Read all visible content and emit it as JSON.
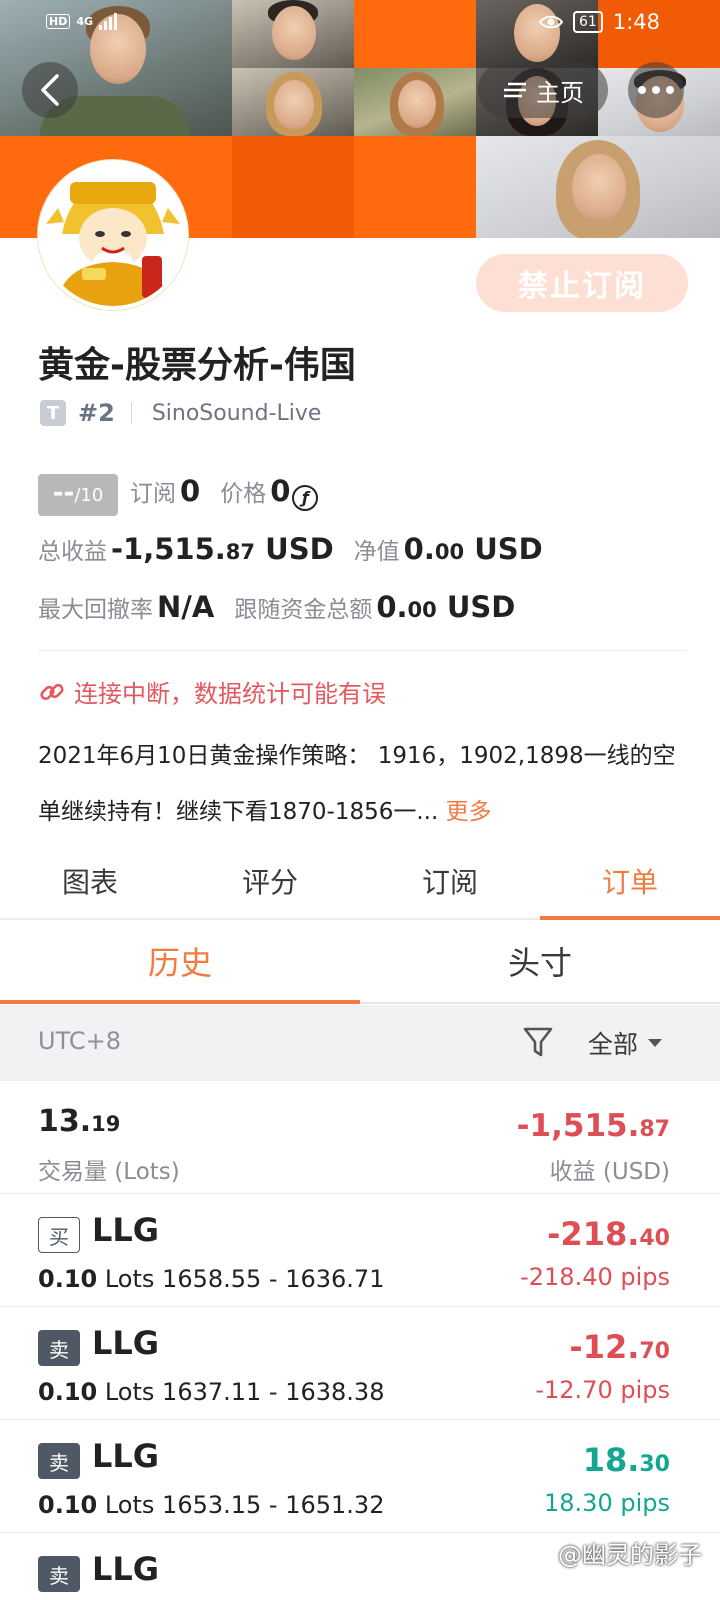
{
  "status_bar": {
    "signal_labels": [
      "HD",
      "4G"
    ],
    "battery": "61",
    "time": "1:48"
  },
  "header": {
    "home_label": "主页",
    "icons": [
      "back-arrow-icon",
      "menu-lines-icon",
      "more-dots-icon",
      "eye-icon"
    ]
  },
  "profile": {
    "name": "黄金-股票分析-伟国",
    "rank": "#2",
    "server": "SinoSound-Live",
    "type_badge": "T",
    "subscribe_button": "禁止订阅"
  },
  "stats": {
    "score": "--",
    "score_max": "/10",
    "subscriptions_label": "订阅",
    "subscriptions_value": "0",
    "price_label": "价格",
    "price_value": "0",
    "currency_symbol": "ƒ",
    "total_profit_label": "总收益",
    "total_profit_int": "-1,515.",
    "total_profit_dec": "87",
    "total_profit_unit": "USD",
    "net_value_label": "净值",
    "net_value_int": "0.",
    "net_value_dec": "00",
    "net_value_unit": "USD",
    "max_drawdown_label": "最大回撤率",
    "max_drawdown_value": "N/A",
    "follow_funds_label": "跟随资金总额",
    "follow_funds_int": "0.",
    "follow_funds_dec": "00",
    "follow_funds_unit": "USD"
  },
  "warning": "连接中断，数据统计可能有误",
  "description": {
    "text": "2021年6月10日黄金操作策略： 1916，1902,1898一线的空单继续持有！继续下看1870-1856一...",
    "more": "更多"
  },
  "tabs": [
    "图表",
    "评分",
    "订阅",
    "订单"
  ],
  "active_tab": "订单",
  "subtabs": [
    "历史",
    "头寸"
  ],
  "active_subtab": "历史",
  "filter": {
    "timezone": "UTC+8",
    "selection": "全部"
  },
  "summary": {
    "volume_int": "13.",
    "volume_dec": "19",
    "volume_label": "交易量 (Lots)",
    "profit_int": "-1,515.",
    "profit_dec": "87",
    "profit_label": "收益 (USD)"
  },
  "orders": [
    {
      "side": "买",
      "symbol": "LLG",
      "lots": "0.10",
      "lots_unit": "Lots",
      "range": "1658.55 - 1636.71",
      "pl_int": "-218.",
      "pl_dec": "40",
      "pips": "-218.40 pips",
      "sign": "neg"
    },
    {
      "side": "卖",
      "symbol": "LLG",
      "lots": "0.10",
      "lots_unit": "Lots",
      "range": "1637.11 - 1638.38",
      "pl_int": "-12.",
      "pl_dec": "70",
      "pips": "-12.70 pips",
      "sign": "neg"
    },
    {
      "side": "卖",
      "symbol": "LLG",
      "lots": "0.10",
      "lots_unit": "Lots",
      "range": "1653.15 - 1651.32",
      "pl_int": "18.",
      "pl_dec": "30",
      "pips": "18.30 pips",
      "sign": "pos"
    },
    {
      "side": "卖",
      "symbol": "LLG",
      "lots": "",
      "lots_unit": "",
      "range": "",
      "pl_int": "",
      "pl_dec": "",
      "pips": "",
      "sign": "pos"
    }
  ],
  "watermark": "@幽灵的影子",
  "colors": {
    "accent": "#f37b40",
    "negative": "#dd4e55",
    "positive": "#14a690",
    "banner_orange": "#ff6a0e"
  }
}
